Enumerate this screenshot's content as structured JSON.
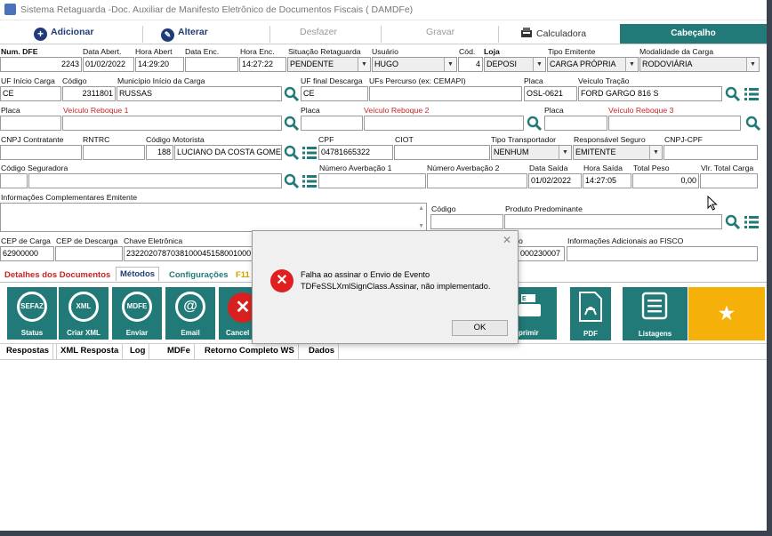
{
  "window": {
    "title": "Sistema Retaguarda -Doc. Auxiliar de Manifesto Eletrônico de Documentos Fiscais ( DAMDFe)"
  },
  "toolbar": {
    "adicionar": "Adicionar",
    "alterar": "Alterar",
    "desfazer": "Desfazer",
    "gravar": "Gravar",
    "calculadora": "Calculadora",
    "cabecalho": "Cabeçalho"
  },
  "form": {
    "num_dfe": {
      "label": "Num. DFE",
      "value": "2243"
    },
    "data_abert": {
      "label": "Data Abert.",
      "value": "01/02/2022"
    },
    "hora_abert": {
      "label": "Hora Abert",
      "value": "14:29:20"
    },
    "data_enc": {
      "label": "Data Enc.",
      "value": ""
    },
    "hora_enc": {
      "label": "Hora Enc.",
      "value": "14:27:22"
    },
    "situacao": {
      "label": "Situação Retaguarda",
      "value": "PENDENTE"
    },
    "usuario": {
      "label": "Usuário",
      "value": "HUGO"
    },
    "cod": {
      "label": "Cód.",
      "value": "4"
    },
    "loja": {
      "label": "Loja",
      "value": "DEPOSI"
    },
    "tipo_emitente": {
      "label": "Tipo Emitente",
      "value": "CARGA PRÓPRIA"
    },
    "modalidade": {
      "label": "Modalidade da Carga",
      "value": "RODOVIÁRIA"
    },
    "uf_inicio": {
      "label": "UF Início Carga",
      "value": "CE"
    },
    "codigo_mun": {
      "label": "Código",
      "value": "2311801"
    },
    "municipio": {
      "label": "Município Início da Carga",
      "value": "RUSSAS"
    },
    "uf_final": {
      "label": "UF final Descarga",
      "value": "CE"
    },
    "ufs_percurso": {
      "label": "UFs Percurso (ex: CEMAPI)",
      "value": ""
    },
    "placa_tracao": {
      "label": "Placa",
      "value": "OSL-0621"
    },
    "veiculo_tracao": {
      "label": "Veículo Tração",
      "value": "FORD GARGO 816 S"
    },
    "placa1": {
      "label": "Placa",
      "value": ""
    },
    "reboque1": {
      "label": "Veículo Reboque 1",
      "value": ""
    },
    "placa2": {
      "label": "Placa",
      "value": ""
    },
    "reboque2": {
      "label": "Veículo Reboque 2",
      "value": ""
    },
    "placa3": {
      "label": "Placa",
      "value": ""
    },
    "reboque3": {
      "label": "Veículo Reboque 3",
      "value": ""
    },
    "cnpj_contratante": {
      "label": "CNPJ Contratante",
      "value": ""
    },
    "rntrc": {
      "label": "RNTRC",
      "value": ""
    },
    "codigo_motorista": {
      "label": "Código Motorista",
      "value": "188"
    },
    "motorista": {
      "value": "LUCIANO DA COSTA GOMES"
    },
    "cpf": {
      "label": "CPF",
      "value": "04781665322"
    },
    "ciot": {
      "label": "CIOT",
      "value": ""
    },
    "tipo_transportador": {
      "label": "Tipo Transportador",
      "value": "NENHUM"
    },
    "responsavel_seguro": {
      "label": "Responsável Seguro",
      "value": "EMITENTE"
    },
    "cnpj_cpf": {
      "label": "CNPJ-CPF",
      "value": ""
    },
    "codigo_seguradora": {
      "label": "Código Seguradora",
      "value": ""
    },
    "num_averbacao1": {
      "label": "Número Averbação 1",
      "value": ""
    },
    "num_averbacao2": {
      "label": "Número Averbação 2",
      "value": ""
    },
    "data_saida": {
      "label": "Data Saída",
      "value": "01/02/2022"
    },
    "hora_saida": {
      "label": "Hora Saída",
      "value": "14:27:05"
    },
    "total_peso": {
      "label": "Total Peso",
      "value": "0,00"
    },
    "vlr_total_carga": {
      "label": "Vlr. Total Carga",
      "value": ""
    },
    "info_compl": {
      "label": "Informações Complementares Emitente",
      "value": ""
    },
    "codigo_prod": {
      "label": "Código",
      "value": ""
    },
    "produto_predominante": {
      "label": "Produto Predominante",
      "value": ""
    },
    "cep_carga": {
      "label": "CEP de Carga",
      "value": "62900000"
    },
    "cep_descarga": {
      "label": "CEP de Descarga",
      "value": ""
    },
    "chave_eletronica": {
      "label": "Chave Eletrônica",
      "value": "2322020787038100045158001000"
    },
    "chave_tail_label": "o",
    "chave_tail": "000230007",
    "info_fisco": {
      "label": "Informações Adicionais ao FISCO",
      "value": ""
    }
  },
  "tabs": {
    "detalhes": "Detalhes dos Documentos",
    "metodos": "Métodos",
    "configuracoes": "Configurações",
    "f11": "F11"
  },
  "methods": {
    "status": "Status",
    "status_icon": "SEFAZ",
    "criar_xml": "Criar XML",
    "criar_icon": "XML",
    "enviar": "Enviar",
    "enviar_icon": "MDFE",
    "email": "Email",
    "email_icon": "@",
    "cancelar": "Cancel",
    "imprimir": "primir",
    "pdf": "PDF",
    "listagens": "Listagens"
  },
  "bottom_tabs": {
    "respostas": "Respostas",
    "xml_resposta": "XML Resposta",
    "log": "Log",
    "mdfe": "MDFe",
    "retorno": "Retorno Completo WS",
    "dados": "Dados"
  },
  "dialog": {
    "line1": "Falha ao assinar o Envio de Evento",
    "line2": "TDFeSSLXmlSignClass.Assinar, não implementado.",
    "ok": "OK"
  },
  "colors": {
    "accent": "#217a78",
    "toolbar_text": "#1f3c78",
    "reboque_label": "#cc2222",
    "star": "#f5b00a"
  }
}
